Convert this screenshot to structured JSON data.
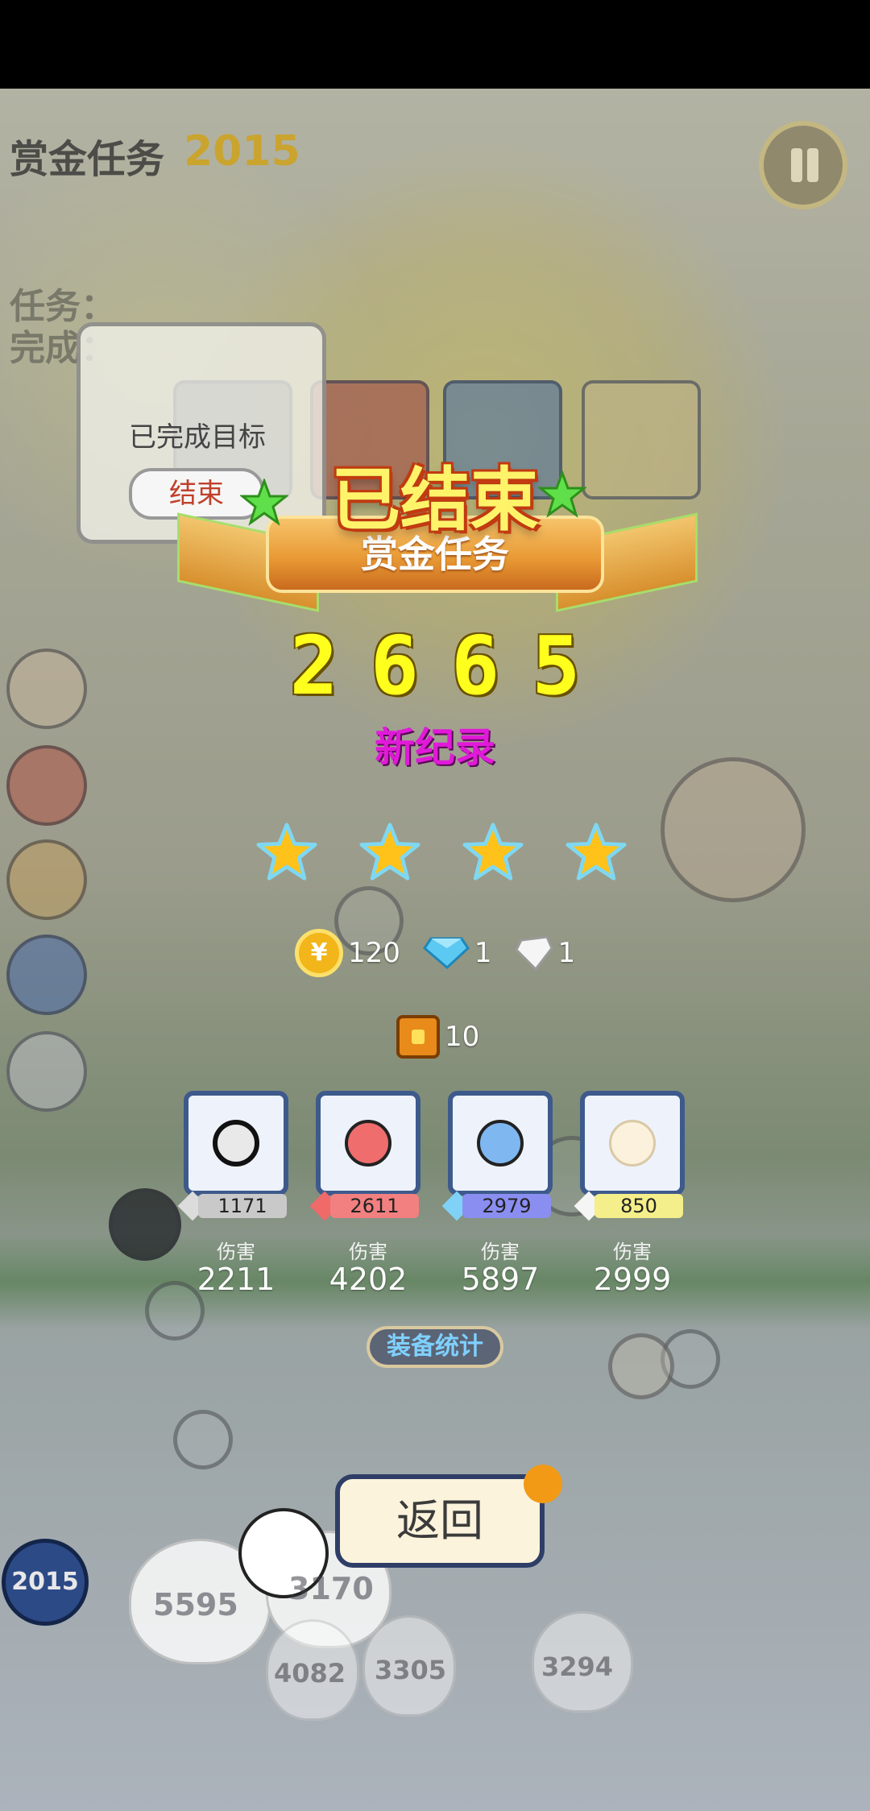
{
  "hud": {
    "mission_name": "赏金任务",
    "mission_level": "2015",
    "task_label": "任务：",
    "done_label": "完成："
  },
  "bubble": {
    "message": "已完成目标",
    "end_button": "结束"
  },
  "result": {
    "title": "已结束",
    "subtitle": "赏金任务",
    "score": "2665",
    "record_label": "新纪录",
    "stars_earned": 4,
    "stars_total": 4
  },
  "rewards": {
    "coin_icon_text": "¥",
    "coins": "120",
    "blue_gems": "1",
    "white_gems": "1",
    "chest_count": "10"
  },
  "heroes": [
    {
      "icon": "gray-angry-face-icon",
      "level": "1171",
      "level_color": "#c9c9c9",
      "gem_color": "#dcdcdc",
      "damage_label": "伤害",
      "damage": "2211"
    },
    {
      "icon": "red-dizzy-face-icon",
      "level": "2611",
      "level_color": "#f28080",
      "gem_color": "#f06a6a",
      "damage_label": "伤害",
      "damage": "4202"
    },
    {
      "icon": "blue-mustache-face-icon",
      "level": "2979",
      "level_color": "#8a8ef0",
      "gem_color": "#7fd2f5",
      "damage_label": "伤害",
      "damage": "5897"
    },
    {
      "icon": "white-bow-face-icon",
      "level": "850",
      "level_color": "#f4ef8a",
      "gem_color": "#f5f5f5",
      "damage_label": "伤害",
      "damage": "2999"
    }
  ],
  "buttons": {
    "stats": "装备统计",
    "back": "返回"
  },
  "scene": {
    "level_badge": "2015",
    "enemy_hp": [
      "5595",
      "3170",
      "4082",
      "3305",
      "3294"
    ]
  }
}
